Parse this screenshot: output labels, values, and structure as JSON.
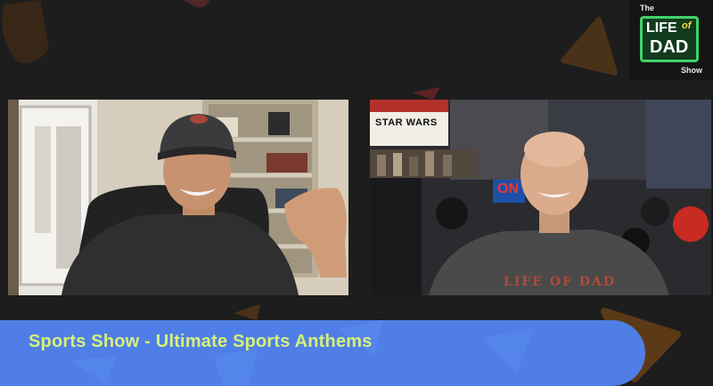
{
  "logo": {
    "the": "The",
    "life": "LIFE",
    "of": "of",
    "dad": "DAD",
    "show": "Show"
  },
  "lower_third": {
    "title": "Sports Show - Ultimate Sports Anthems"
  },
  "left_video": {
    "participant": "host-left"
  },
  "right_video": {
    "participant": "host-right",
    "poster_text": "STAR WARS",
    "sign_text": "ON",
    "shirt_text": "LIFE OF DAD"
  },
  "colors": {
    "background": "#1d1d1d",
    "banner": "#4f7fe6",
    "banner_text": "#d7f07a",
    "logo_neon": "#3fd36b",
    "shape_brown": "#5a3a1c"
  }
}
